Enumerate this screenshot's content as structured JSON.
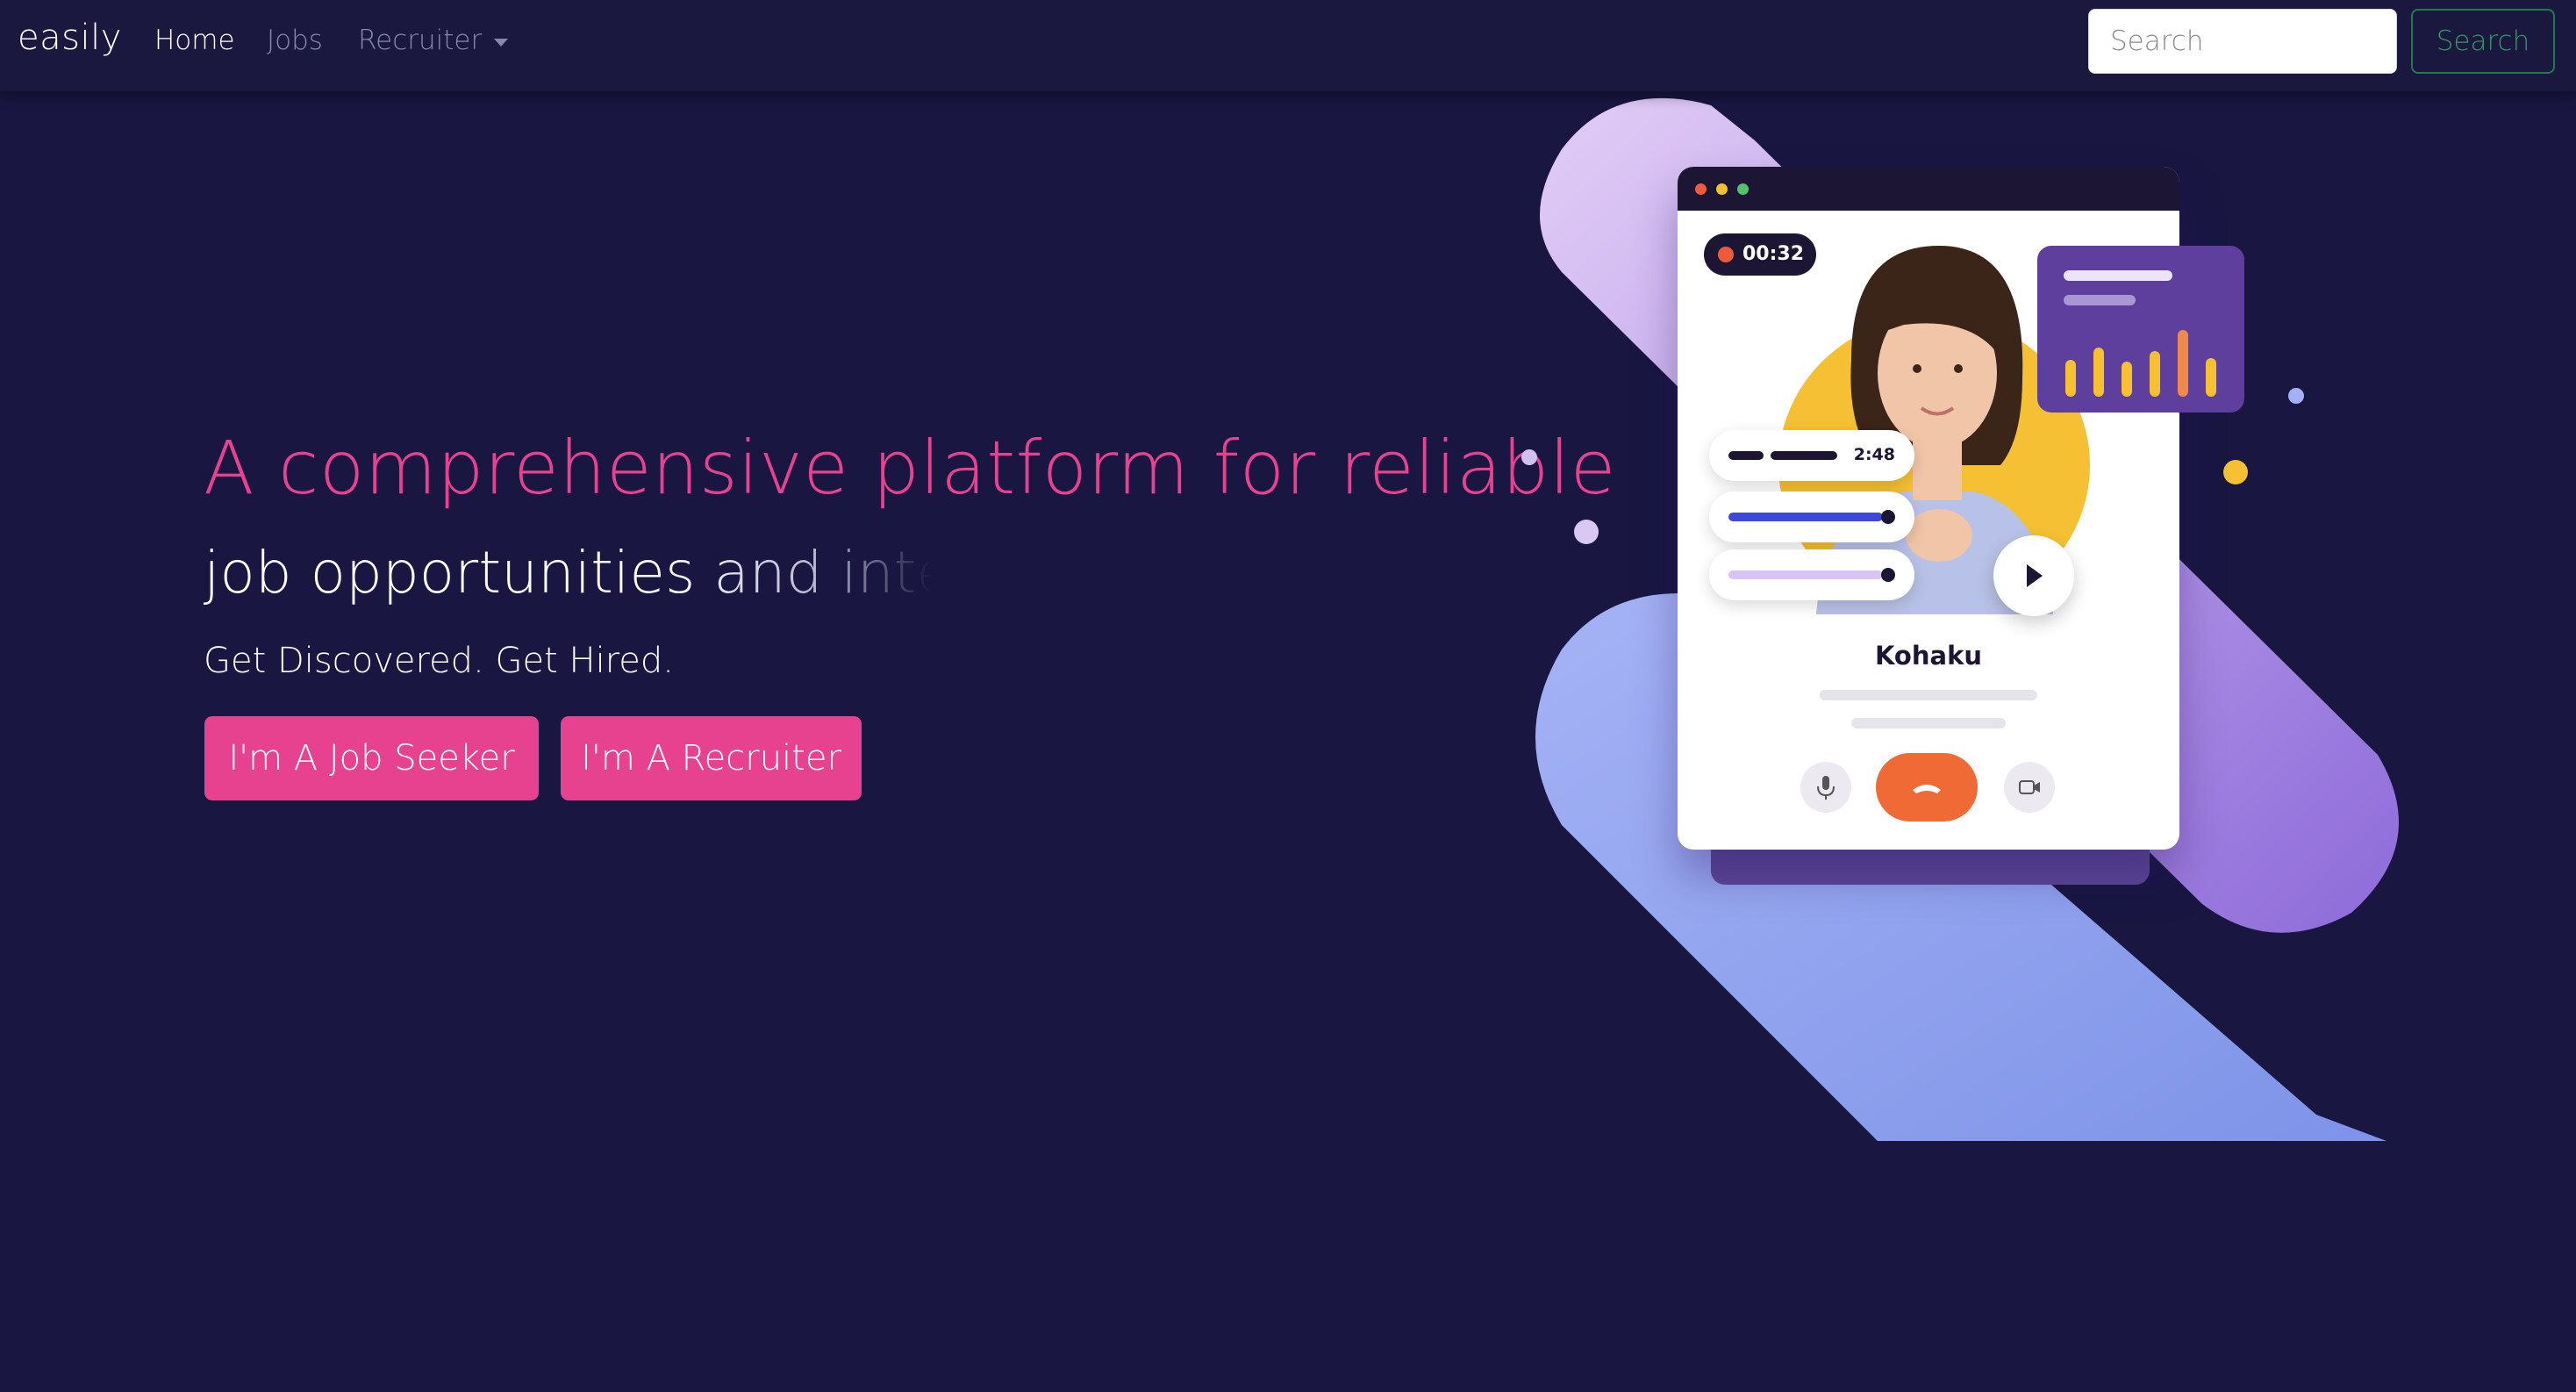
{
  "navbar": {
    "brand": "easily",
    "links": [
      {
        "label": "Home",
        "active": true
      },
      {
        "label": "Jobs",
        "active": false
      },
      {
        "label": "Recruiter",
        "active": false,
        "has_dropdown": true
      }
    ],
    "search_placeholder": "Search",
    "search_button": "Search"
  },
  "hero": {
    "headline": "A comprehensive platform for reliable",
    "typing_text": "job opportunities and inter",
    "tagline": "Get Discovered. Get Hired.",
    "cta_seeker": "I'm A Job Seeker",
    "cta_recruiter": "I'm A Recruiter"
  },
  "illustration": {
    "call_timer": "00:32",
    "clip_duration": "2:48",
    "caller_name": "Kohaku",
    "icons": [
      "microphone-icon",
      "hang-up-icon",
      "video-camera-icon",
      "play-icon"
    ]
  },
  "colors": {
    "background": "#191642",
    "accent": "#e6428f",
    "search_button": "#2f9a62"
  }
}
